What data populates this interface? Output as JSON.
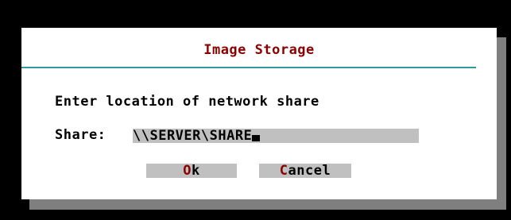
{
  "dialog": {
    "title": "Image Storage",
    "prompt": "Enter location of network share",
    "share_label": "Share:",
    "share_value": "\\\\SERVER\\SHARE"
  },
  "buttons": {
    "ok": {
      "hot": "O",
      "rest": "k"
    },
    "cancel": {
      "hot": "C",
      "rest": "ancel"
    }
  },
  "colors": {
    "background": "#000000",
    "dialog": "#ffffff",
    "shadow": "#7f7f7f",
    "title": "#8b0000",
    "divider": "#2e9a9a",
    "field": "#c0c0c0",
    "hotkey": "#8b0000"
  }
}
